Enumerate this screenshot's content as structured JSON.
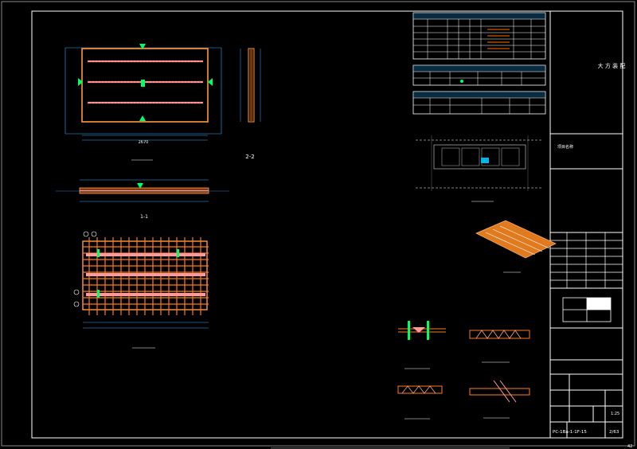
{
  "title_block": {
    "company": "大 方 装 配",
    "project_name_label": "项目名称",
    "sheet_no_a": "PC-1Ba-1-1F-15",
    "page": "2/63",
    "sheet_number": "42",
    "scale": "1:25"
  },
  "labels": {
    "section_22": "2-2",
    "section_11": "1-1",
    "dim_total": "2670"
  },
  "rebar_table_rows": 5,
  "accent_colors": {
    "frame": "#ffffff",
    "rebar": "#ff6a00",
    "bar_fill": "#ff9a9a",
    "symbol": "#00ff66",
    "table_header": "#1c7ab5",
    "highlight": "#00b4e6",
    "dim": "#2ea8ff"
  }
}
